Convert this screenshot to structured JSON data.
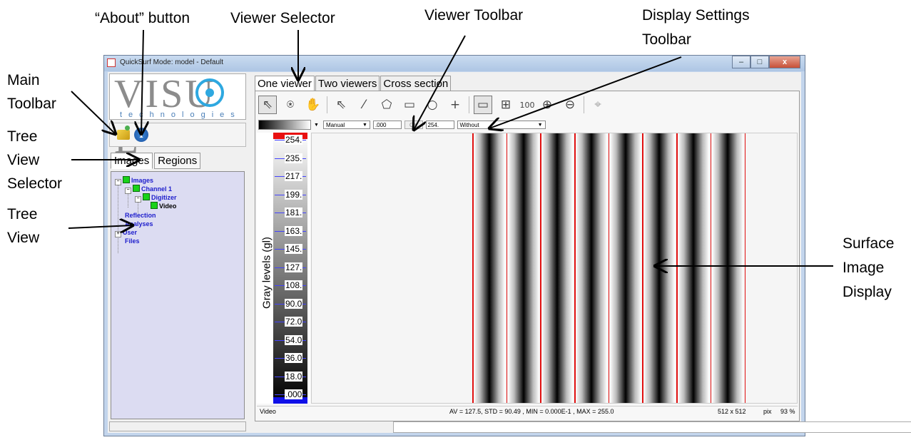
{
  "annotations": {
    "about_button": "“About” button",
    "viewer_selector": "Viewer Selector",
    "viewer_toolbar": "Viewer Toolbar",
    "display_settings_line1": "Display Settings",
    "display_settings_line2": "Toolbar",
    "main_toolbar_line1": "Main",
    "main_toolbar_line2": "Toolbar",
    "tree_view_selector_line1": "Tree",
    "tree_view_selector_line2": "View",
    "tree_view_selector_line3": "Selector",
    "tree_view_line1": "Tree",
    "tree_view_line2": "View",
    "surface_line1": "Surface",
    "surface_line2": "Image",
    "surface_line3": "Display"
  },
  "window": {
    "title": "QuickSurf Mode: model -  Default",
    "minimize": "–",
    "maximize": "□",
    "close": "x"
  },
  "logo": {
    "text": "VISU  L",
    "sub": "technologies"
  },
  "main_toolbar": {
    "open_icon": "open-folder-icon",
    "about_icon": "info-icon",
    "about_glyph": "i"
  },
  "tree_tabs": [
    "Images",
    "Regions"
  ],
  "tree": {
    "images": "Images",
    "channel1": "Channel 1",
    "digitizer": "Digitizer",
    "video": "Video",
    "reflection": "Reflection",
    "analyses": "Analyses",
    "user": "User",
    "files": "Files"
  },
  "viewer_tabs": [
    "One viewer",
    "Two viewers",
    "Cross section"
  ],
  "viewer_toolbar": {
    "icons": [
      "select-arrow-icon",
      "probe-icon",
      "pan-hand-icon",
      "point-select-icon",
      "line-tool-icon",
      "polygon-tool-icon",
      "rectangle-tool-icon",
      "ellipse-tool-icon",
      "add-point-icon",
      "fit-window-icon",
      "fit-page-icon",
      "zoom-100-icon",
      "zoom-in-icon",
      "zoom-out-icon",
      "crosshair-icon"
    ],
    "zoom100_label": "100"
  },
  "display_settings": {
    "mode": "Manual",
    "min_value": ".000",
    "ok_label": "OK",
    "max_value": "254.",
    "filter": "Without"
  },
  "scale": {
    "ylabel": "Gray levels (gl)",
    "ticks": [
      "254.",
      "235.",
      "217.",
      "199.",
      "181.",
      "163.",
      "145.",
      "127.",
      "108.",
      "90.0",
      "72.0",
      "54.0",
      "36.0",
      "18.0",
      ".000"
    ]
  },
  "image": {
    "stripe_count": 8
  },
  "viewer_status": {
    "name": "Video",
    "stats": "AV = 127.5, STD = 90.49 , MIN = 0.000E-1 , MAX = 255.0",
    "size": "512 x 512",
    "unit": "pix",
    "zoom": "93 %"
  }
}
